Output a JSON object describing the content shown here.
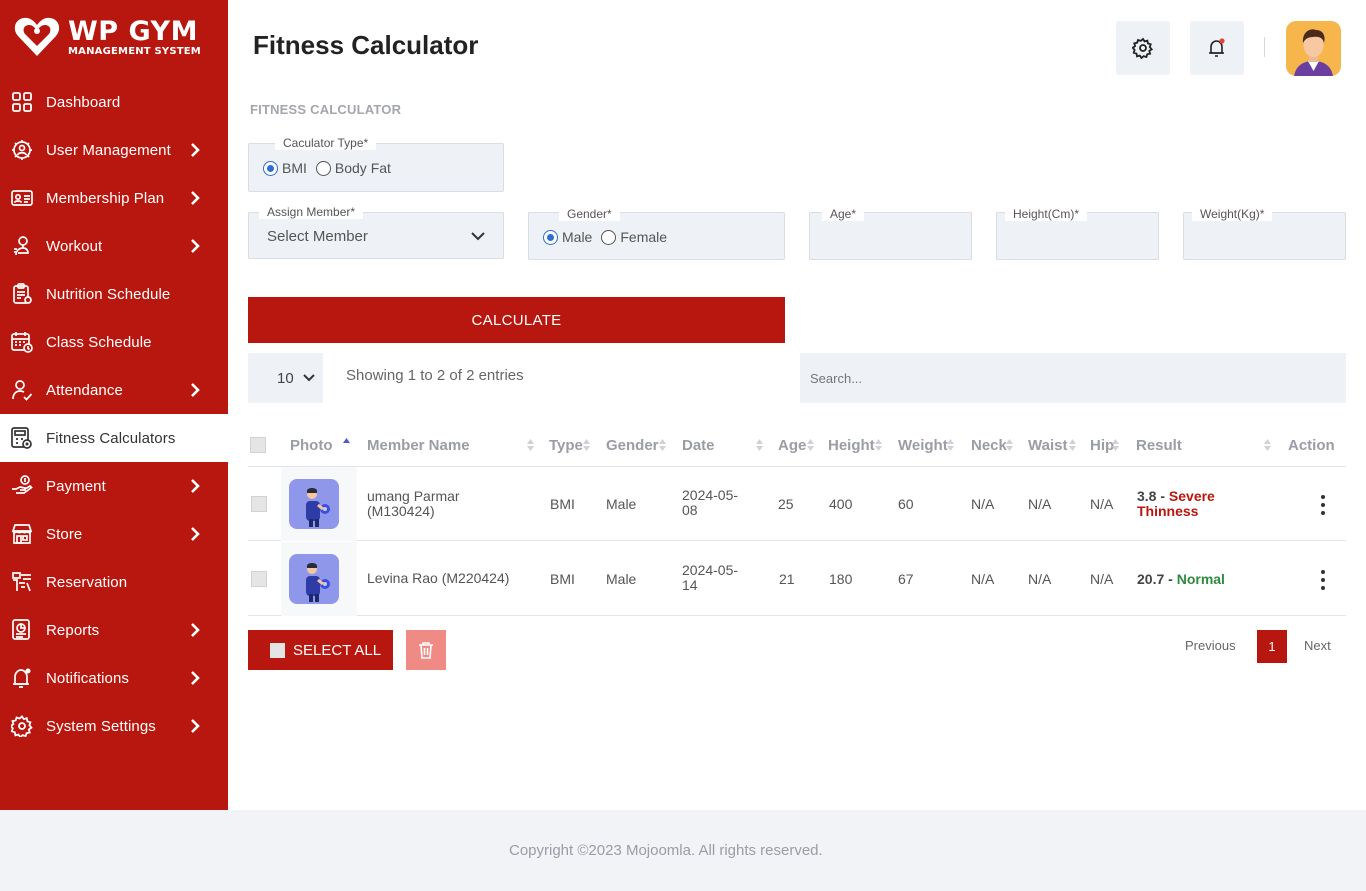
{
  "brand": {
    "title": "WP GYM",
    "subtitle": "MANAGEMENT SYSTEM"
  },
  "sidebar": {
    "items": [
      {
        "label": "Dashboard",
        "icon": "grid-icon",
        "has_submenu": false,
        "active": false
      },
      {
        "label": "User Management",
        "icon": "users-gear-icon",
        "has_submenu": true,
        "active": false
      },
      {
        "label": "Membership Plan",
        "icon": "id-card-icon",
        "has_submenu": true,
        "active": false
      },
      {
        "label": "Workout",
        "icon": "workout-icon",
        "has_submenu": true,
        "active": false
      },
      {
        "label": "Nutrition Schedule",
        "icon": "clipboard-icon",
        "has_submenu": false,
        "active": false
      },
      {
        "label": "Class Schedule",
        "icon": "calendar-icon",
        "has_submenu": false,
        "active": false
      },
      {
        "label": "Attendance",
        "icon": "user-check-icon",
        "has_submenu": true,
        "active": false
      },
      {
        "label": "Fitness Calculators",
        "icon": "calculator-icon",
        "has_submenu": false,
        "active": true
      },
      {
        "label": "Payment",
        "icon": "payment-icon",
        "has_submenu": true,
        "active": false
      },
      {
        "label": "Store",
        "icon": "store-icon",
        "has_submenu": true,
        "active": false
      },
      {
        "label": "Reservation",
        "icon": "reservation-icon",
        "has_submenu": false,
        "active": false
      },
      {
        "label": "Reports",
        "icon": "reports-icon",
        "has_submenu": true,
        "active": false
      },
      {
        "label": "Notifications",
        "icon": "bell-icon",
        "has_submenu": true,
        "active": false
      },
      {
        "label": "System Settings",
        "icon": "gear-icon",
        "has_submenu": true,
        "active": false
      }
    ]
  },
  "header": {
    "title": "Fitness Calculator"
  },
  "form": {
    "section_label": "FITNESS CALCULATOR",
    "calc_type": {
      "legend": "Caculator Type*",
      "options": [
        "BMI",
        "Body Fat"
      ],
      "selected": "BMI"
    },
    "member": {
      "legend": "Assign Member*",
      "value": "Select Member"
    },
    "gender": {
      "legend": "Gender*",
      "options": [
        "Male",
        "Female"
      ],
      "selected": "Male"
    },
    "age": {
      "legend": "Age*",
      "value": ""
    },
    "height": {
      "legend": "Height(Cm)*",
      "value": ""
    },
    "weight": {
      "legend": "Weight(Kg)*",
      "value": ""
    },
    "calculate_label": "CALCULATE"
  },
  "table_controls": {
    "page_length": "10",
    "info": "Showing 1 to 2 of 2 entries",
    "search_placeholder": "Search..."
  },
  "table": {
    "columns": [
      "Photo",
      "Member Name",
      "Type",
      "Gender",
      "Date",
      "Age",
      "Height",
      "Weight",
      "Neck",
      "Waist",
      "Hip",
      "Result",
      "Action"
    ],
    "rows": [
      {
        "name_line1": "umang Parmar",
        "name_line2": "(M130424)",
        "type": "BMI",
        "gender": "Male",
        "date_line1": "2024-05-",
        "date_line2": "08",
        "age": "25",
        "height": "400",
        "weight": "60",
        "neck": "N/A",
        "waist": "N/A",
        "hip": "N/A",
        "result_value": "3.8 -",
        "result_label_1": "Severe",
        "result_label_2": "Thinness",
        "result_status": "bad"
      },
      {
        "name_line1": "Levina Rao (M220424)",
        "name_line2": "",
        "type": "BMI",
        "gender": "Male",
        "date_line1": "2024-05-",
        "date_line2": "14",
        "age": "21",
        "height": "180",
        "weight": "67",
        "neck": "N/A",
        "waist": "N/A",
        "hip": "N/A",
        "result_value": "20.7 -",
        "result_label_1": "Normal",
        "result_label_2": "",
        "result_status": "good"
      }
    ]
  },
  "bulk": {
    "select_all_label": "SELECT ALL"
  },
  "pagination": {
    "previous": "Previous",
    "current": "1",
    "next": "Next"
  },
  "footer": {
    "text": "Copyright ©2023 Mojoomla. All rights reserved."
  },
  "colors": {
    "brand_red": "#b8170f",
    "panel_bg": "#eef1f6",
    "good": "#2e8b3e"
  }
}
